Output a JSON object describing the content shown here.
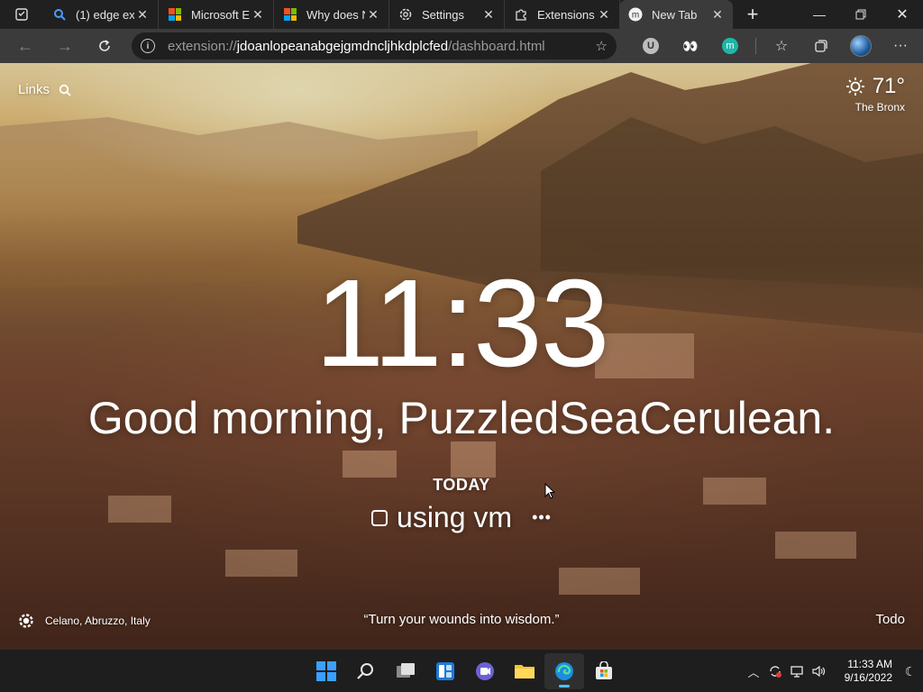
{
  "browser": {
    "tabs": [
      {
        "title": "(1) edge ext",
        "icon": "search-favicon-icon",
        "active": false
      },
      {
        "title": "Microsoft E",
        "icon": "microsoft-logo-icon",
        "active": false
      },
      {
        "title": "Why does N",
        "icon": "microsoft-logo-icon",
        "active": false
      },
      {
        "title": "Settings",
        "icon": "settings-gear-icon",
        "active": false
      },
      {
        "title": "Extensions",
        "icon": "puzzle-piece-icon",
        "active": false
      },
      {
        "title": "New Tab",
        "icon": "momentum-m-icon",
        "active": true
      }
    ],
    "address": {
      "url_prefix": "extension://",
      "url_host": "jdoanlopeanabgejgmdncljhkdplcfed",
      "url_path": "/dashboard.html"
    },
    "extensions": [
      {
        "name": "u-extension-icon",
        "label": "U"
      },
      {
        "name": "eyes-extension-icon",
        "label": "👀"
      },
      {
        "name": "momentum-extension-icon",
        "label": "m"
      }
    ]
  },
  "dashboard": {
    "links_label": "Links",
    "weather": {
      "temperature": "71°",
      "location": "The Bronx",
      "condition_icon": "sun-icon"
    },
    "time": "11:33",
    "greeting": "Good morning, PuzzledSeaCerulean.",
    "focus": {
      "label": "TODAY",
      "task": "using vm",
      "more": "•••"
    },
    "photo_location": "Celano, Abruzzo, Italy",
    "quote": "“Turn your wounds into wisdom.”",
    "todo_label": "Todo"
  },
  "taskbar": {
    "apps": [
      {
        "name": "start-button",
        "active": false
      },
      {
        "name": "search-button",
        "active": false
      },
      {
        "name": "task-view-button",
        "active": false
      },
      {
        "name": "widgets-button",
        "active": false
      },
      {
        "name": "teams-chat-button",
        "active": false
      },
      {
        "name": "file-explorer-button",
        "active": false
      },
      {
        "name": "edge-browser-button",
        "active": true
      },
      {
        "name": "microsoft-store-button",
        "active": false
      }
    ],
    "clock_time": "11:33 AM",
    "clock_date": "9/16/2022"
  },
  "colors": {
    "accent": "#4cc2ff",
    "tabbar": "#202020",
    "toolbar": "#3b3b3b",
    "taskbar": "#1e1e1e"
  }
}
